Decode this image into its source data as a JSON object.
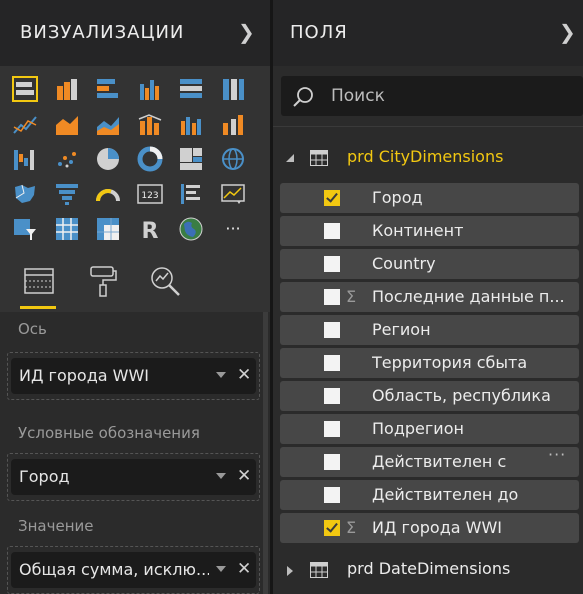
{
  "visualizations": {
    "title": "ВИЗУАЛИЗАЦИИ",
    "gallery_icons": [
      "stacked-bar-icon",
      "stacked-column-icon",
      "clustered-bar-icon",
      "clustered-column-icon",
      "100-stacked-bar-icon",
      "100-stacked-column-icon",
      "line-chart-icon",
      "area-chart-icon",
      "stacked-area-icon",
      "line-column-icon",
      "line-clustered-column-icon",
      "ribbon-chart-icon",
      "waterfall-icon",
      "scatter-icon",
      "pie-icon",
      "donut-icon",
      "treemap-icon",
      "map-icon",
      "filled-map-icon",
      "funnel-icon",
      "gauge-icon",
      "card-icon",
      "multirow-card-icon",
      "kpi-icon",
      "slicer-icon",
      "table-icon",
      "matrix-icon",
      "r-visual-icon",
      "globe-icon",
      "more-icon"
    ],
    "more_label": "···",
    "r_label": "R",
    "card_label": "123",
    "tabs": [
      "fields-tab",
      "format-tab",
      "analytics-tab"
    ]
  },
  "wells": [
    {
      "label": "Ось",
      "value": "ИД города WWI"
    },
    {
      "label": "Условные обозначения",
      "value": "Город"
    },
    {
      "label": "Значение",
      "value": "Общая сумма, исклю..."
    }
  ],
  "fields": {
    "title": "ПОЛЯ",
    "search_placeholder": "Поиск",
    "tables": [
      {
        "name": "prd CityDimensions",
        "expanded": true,
        "accent": "#f2c811",
        "fields": [
          {
            "name": "Город",
            "checked": true,
            "sigma": false,
            "more": false
          },
          {
            "name": "Континент",
            "checked": false,
            "sigma": false,
            "more": false
          },
          {
            "name": "Country",
            "checked": false,
            "sigma": false,
            "more": false
          },
          {
            "name": "Последние данные п...",
            "checked": false,
            "sigma": true,
            "more": false
          },
          {
            "name": "Регион",
            "checked": false,
            "sigma": false,
            "more": false
          },
          {
            "name": "Территория сбыта",
            "checked": false,
            "sigma": false,
            "more": false
          },
          {
            "name": "Область, республика",
            "checked": false,
            "sigma": false,
            "more": false
          },
          {
            "name": "Подрегион",
            "checked": false,
            "sigma": false,
            "more": false
          },
          {
            "name": "Действителен с",
            "checked": false,
            "sigma": false,
            "more": true
          },
          {
            "name": "Действителен до",
            "checked": false,
            "sigma": false,
            "more": false
          },
          {
            "name": "ИД города WWI",
            "checked": true,
            "sigma": true,
            "more": false
          }
        ]
      },
      {
        "name": "prd DateDimensions",
        "expanded": false,
        "accent": "#ececec"
      }
    ],
    "more_label": "···",
    "sigma_label": "Σ"
  },
  "colors": {
    "accent": "#f2c811",
    "panel": "#2b2b2b",
    "header": "#252526",
    "row": "#474747"
  }
}
